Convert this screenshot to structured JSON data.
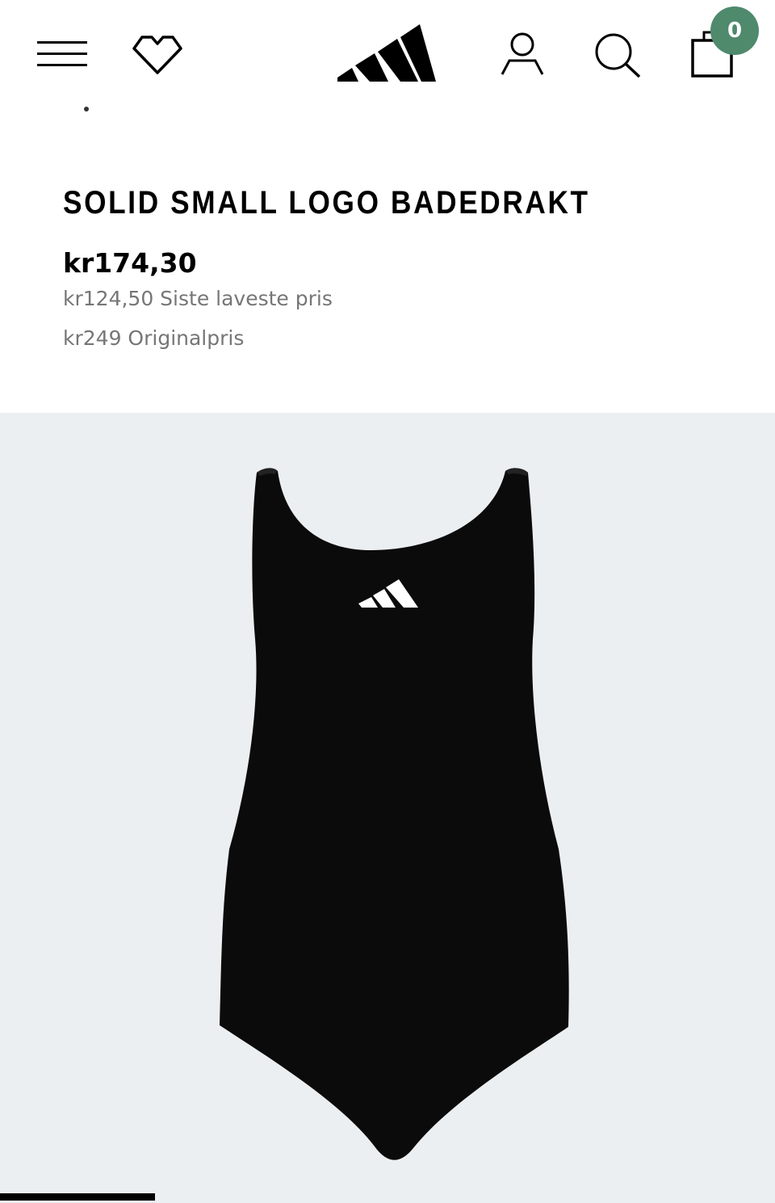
{
  "header": {
    "icons": {
      "menu": "hamburger-menu-icon",
      "wishlist": "heart-icon",
      "logo": "adidas-logo",
      "account": "user-icon",
      "search": "search-icon",
      "bag": "shopping-bag-icon"
    },
    "bag_count": "0",
    "bag_badge_color": "#4f8a6d"
  },
  "product": {
    "title": "SOLID SMALL LOGO BADEDRAKT",
    "price_current": "kr174,30",
    "price_lowest": "kr124,50 Siste laveste pris",
    "price_original": "kr249 Originalpris"
  },
  "gallery": {
    "background_color": "#eceff1",
    "progress_fraction": 0.2
  }
}
